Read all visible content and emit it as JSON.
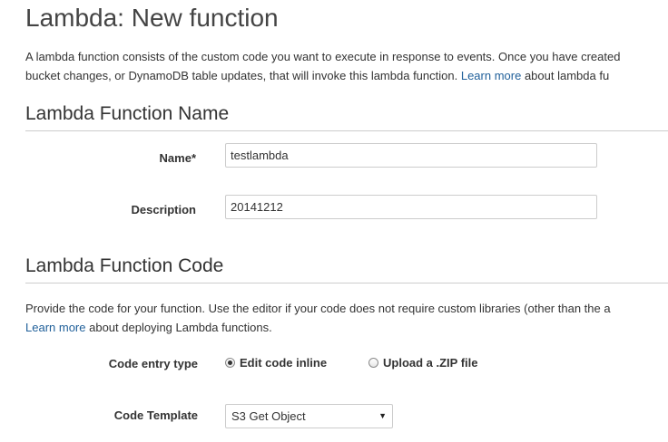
{
  "page": {
    "title": "Lambda: New function",
    "intro_line1": "A lambda function consists of the custom code you want to execute in response to events. Once you have created",
    "intro_line2_pre": "bucket changes, or DynamoDB table updates, that will invoke this lambda function.",
    "intro_link": "Learn more",
    "intro_line2_post": "about lambda fu"
  },
  "name_section": {
    "title": "Lambda Function Name",
    "name_label": "Name*",
    "name_value": "testlambda",
    "description_label": "Description",
    "description_value": "20141212"
  },
  "code_section": {
    "title": "Lambda Function Code",
    "intro_line1": "Provide the code for your function. Use the editor if your code does not require custom libraries (other than the a",
    "intro_link": "Learn more",
    "intro_line2_post": "about deploying Lambda functions.",
    "entry_type_label": "Code entry type",
    "entry_options": [
      {
        "label": "Edit code inline",
        "selected": true
      },
      {
        "label": "Upload a .ZIP file",
        "selected": false
      }
    ],
    "template_label": "Code Template",
    "template_value": "S3 Get Object"
  },
  "colors": {
    "link": "#1f5f99",
    "rule": "#cccccc",
    "text": "#333333"
  }
}
